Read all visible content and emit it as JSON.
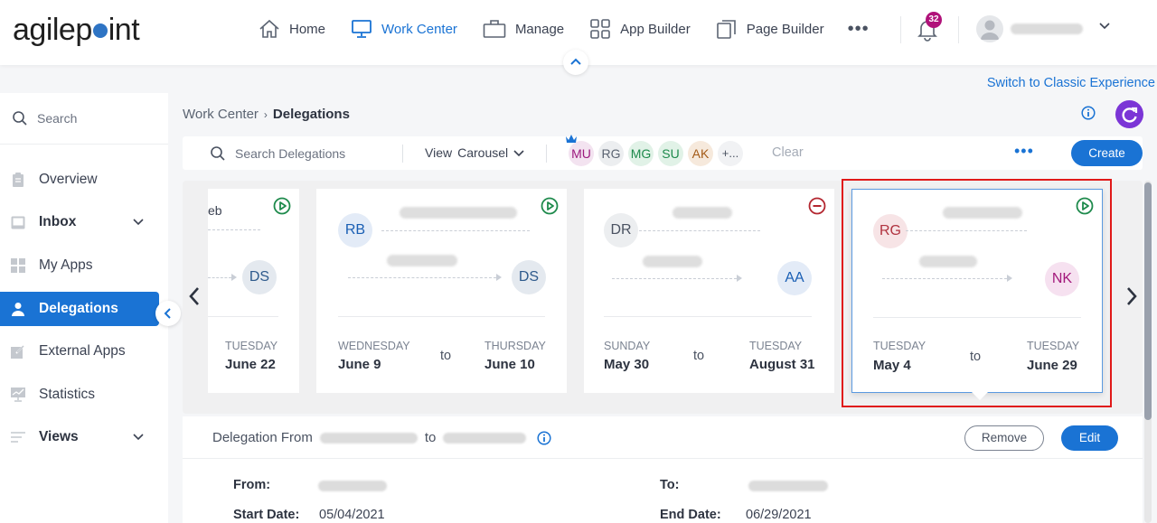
{
  "header": {
    "logo_text_left": "agilep",
    "logo_text_right": "int",
    "nav": [
      {
        "label": "Home",
        "icon": "home-icon",
        "active": false
      },
      {
        "label": "Work Center",
        "icon": "monitor-icon",
        "active": true
      },
      {
        "label": "Manage",
        "icon": "briefcase-icon",
        "active": false
      },
      {
        "label": "App Builder",
        "icon": "grid-icon",
        "active": false
      },
      {
        "label": "Page Builder",
        "icon": "pages-icon",
        "active": false
      }
    ],
    "more_label": "•••",
    "notification_count": "32",
    "switch_classic_label": "Switch to Classic Experience"
  },
  "sidebar": {
    "search_placeholder": "Search",
    "items": [
      {
        "label": "Overview",
        "icon": "clipboard-icon",
        "expandable": false
      },
      {
        "label": "Inbox",
        "icon": "inbox-icon",
        "expandable": true
      },
      {
        "label": "My Apps",
        "icon": "apps-grid-icon",
        "expandable": false
      },
      {
        "label": "Delegations",
        "icon": "person-icon",
        "expandable": false,
        "active": true
      },
      {
        "label": "External Apps",
        "icon": "external-link-icon",
        "expandable": false
      },
      {
        "label": "Statistics",
        "icon": "chart-monitor-icon",
        "expandable": false
      },
      {
        "label": "Views",
        "icon": "list-lines-icon",
        "expandable": true
      }
    ]
  },
  "breadcrumb": {
    "parent": "Work Center",
    "separator": "›",
    "current": "Delegations"
  },
  "toolbar": {
    "search_placeholder": "Search Delegations",
    "view_label": "View",
    "view_value": "Carousel",
    "users": [
      {
        "initials": "MU",
        "fg": "#9c1a7e",
        "bg": "#f3e3f0",
        "crown": true
      },
      {
        "initials": "RG",
        "fg": "#5b6472",
        "bg": "#eceef0"
      },
      {
        "initials": "MG",
        "fg": "#1e8a4c",
        "bg": "#e1f2e7"
      },
      {
        "initials": "SU",
        "fg": "#1e8a4c",
        "bg": "#e1f2e7"
      },
      {
        "initials": "AK",
        "fg": "#a35a17",
        "bg": "#f6e9dc"
      },
      {
        "initials": "+...",
        "fg": "#4a5261",
        "bg": "#f1f2f4"
      }
    ],
    "clear_label": "Clear",
    "more_label": "•••",
    "create_label": "Create"
  },
  "carousel": {
    "cards": [
      {
        "partial": true,
        "from_name_fragment": "eb",
        "to_initials": "DS",
        "to_fg": "#2e5a8c",
        "to_bg": "#e4e9ef",
        "status": "active",
        "end_day": "TUESDAY",
        "end_date": "June 22"
      },
      {
        "from_initials": "RB",
        "from_fg": "#1a5fb4",
        "from_bg": "#e3ebf7",
        "to_initials": "DS",
        "to_fg": "#2e5a8c",
        "to_bg": "#e4e9ef",
        "status": "active",
        "start_day": "WEDNESDAY",
        "start_date": "June 9",
        "to_label": "to",
        "end_day": "THURSDAY",
        "end_date": "June 10"
      },
      {
        "from_initials": "DR",
        "from_fg": "#4a5261",
        "from_bg": "#eceef0",
        "to_initials": "AA",
        "to_fg": "#1a5fb4",
        "to_bg": "#e3ebf7",
        "status": "inactive",
        "start_day": "SUNDAY",
        "start_date": "May 30",
        "to_label": "to",
        "end_day": "TUESDAY",
        "end_date": "August 31"
      },
      {
        "selected": true,
        "from_initials": "RG",
        "from_fg": "#b0333f",
        "from_bg": "#f7e4e6",
        "to_initials": "NK",
        "to_fg": "#a3197c",
        "to_bg": "#f6e1f0",
        "status": "active",
        "start_day": "TUESDAY",
        "start_date": "May 4",
        "to_label": "to",
        "end_day": "TUESDAY",
        "end_date": "June 29"
      }
    ]
  },
  "detail": {
    "title_prefix": "Delegation From",
    "title_mid": "to",
    "remove_label": "Remove",
    "edit_label": "Edit",
    "from_label": "From:",
    "to_label": "To:",
    "start_label": "Start Date:",
    "start_value": "05/04/2021",
    "end_label": "End Date:",
    "end_value": "06/29/2021"
  },
  "colors": {
    "accent": "#1a73d4",
    "active_status": "#1e8a4c",
    "inactive_status": "#b3262f",
    "refresh": "#7b35d6",
    "badge": "#b0127a",
    "highlight": "#e01919"
  }
}
